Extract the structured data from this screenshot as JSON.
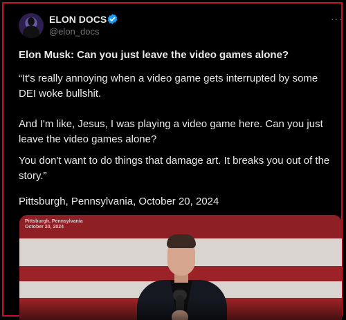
{
  "author": {
    "name": "ELON DOCS",
    "handle": "@elon_docs",
    "verified_color": "#1d9bf0"
  },
  "more_icon": "···",
  "post": {
    "title": "Elon Musk: Can you just leave the video games alone?",
    "paragraphs": [
      "“It's really annoying when a video game gets interrupted by some DEI woke bullshit.",
      "And I'm like, Jesus, I was playing a video game here. Can you just leave the video games alone?",
      "You don't want to do things that damage art. It breaks you out of the story.”",
      "Pittsburgh, Pennsylvania, October 20, 2024"
    ]
  },
  "media": {
    "caption_line1": "Pittsburgh, Pennsylvania",
    "caption_line2": "October 20, 2024"
  },
  "colors": {
    "background": "#000000",
    "text": "#e7e9ea",
    "muted": "#71767b",
    "frame_border": "#c8102e",
    "flag_red": "#9b2226",
    "flag_white": "#d9d4d0"
  }
}
